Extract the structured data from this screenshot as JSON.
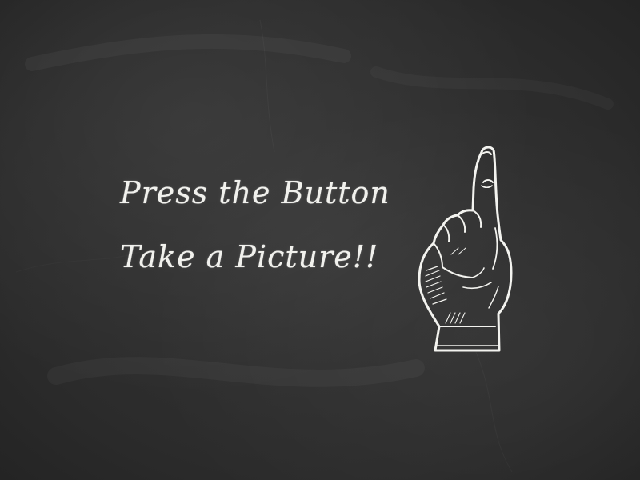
{
  "board": {
    "background_color": "#2f2f2f",
    "chalk_color": "#f1f1ed"
  },
  "prompt": {
    "line1": "Press the Button",
    "line2": "Take a Picture!!"
  },
  "icons": {
    "hand": "pointing-up-hand-icon"
  }
}
